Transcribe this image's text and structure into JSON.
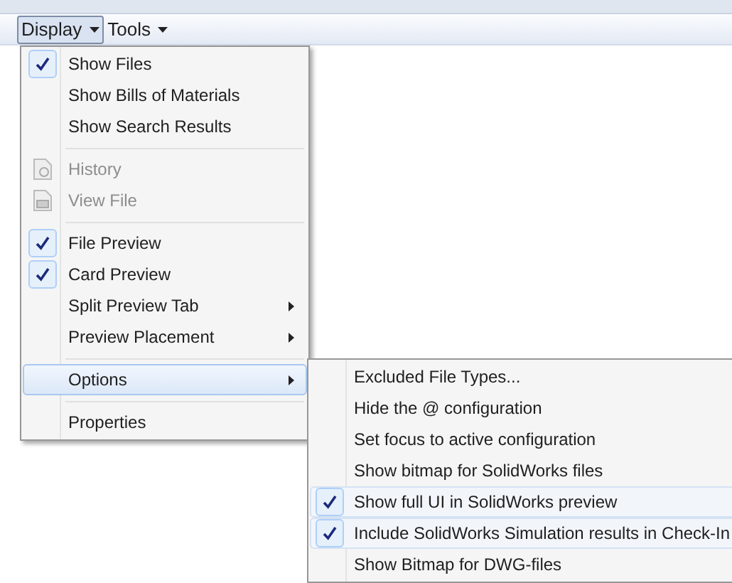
{
  "menubar": [
    {
      "label": "Display",
      "selected": true
    },
    {
      "label": "Tools",
      "selected": false
    }
  ],
  "display_menu": [
    {
      "kind": "item",
      "label": "Show Files",
      "checked": true,
      "disabled": false,
      "submenu": false,
      "selected": false
    },
    {
      "kind": "item",
      "label": "Show Bills of Materials",
      "checked": false,
      "disabled": false,
      "submenu": false,
      "selected": false
    },
    {
      "kind": "item",
      "label": "Show Search Results",
      "checked": false,
      "disabled": false,
      "submenu": false,
      "selected": false
    },
    {
      "kind": "separator"
    },
    {
      "kind": "history",
      "label": "History",
      "disabled": true,
      "selected": false
    },
    {
      "kind": "viewfile",
      "label": "View File",
      "disabled": true,
      "selected": false
    },
    {
      "kind": "separator"
    },
    {
      "kind": "item",
      "label": "File Preview",
      "checked": true,
      "disabled": false,
      "submenu": false,
      "selected": false
    },
    {
      "kind": "item",
      "label": "Card Preview",
      "checked": true,
      "disabled": false,
      "submenu": false,
      "selected": false
    },
    {
      "kind": "item",
      "label": "Split Preview Tab",
      "checked": false,
      "disabled": false,
      "submenu": true,
      "selected": false
    },
    {
      "kind": "item",
      "label": "Preview Placement",
      "checked": false,
      "disabled": false,
      "submenu": true,
      "selected": false
    },
    {
      "kind": "separator"
    },
    {
      "kind": "item",
      "label": "Options",
      "checked": false,
      "disabled": false,
      "submenu": true,
      "selected": true
    },
    {
      "kind": "separator"
    },
    {
      "kind": "item",
      "label": "Properties",
      "checked": false,
      "disabled": false,
      "submenu": false,
      "selected": false
    }
  ],
  "options_menu": [
    {
      "label": "Excluded File Types...",
      "checked": false
    },
    {
      "label": "Hide the @ configuration",
      "checked": false
    },
    {
      "label": "Set focus to active configuration",
      "checked": false
    },
    {
      "label": "Show bitmap for SolidWorks files",
      "checked": false
    },
    {
      "label": "Show full UI in SolidWorks preview",
      "checked": true
    },
    {
      "label": "Include SolidWorks Simulation results in Check-In",
      "checked": true
    },
    {
      "label": "Show Bitmap for DWG-files",
      "checked": false
    }
  ]
}
